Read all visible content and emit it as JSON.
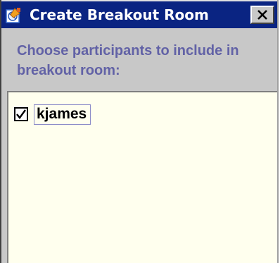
{
  "window": {
    "title": "Create Breakout Room",
    "title_icon": "app-icon",
    "close_icon": "close-icon"
  },
  "colors": {
    "titlebar": "#0a2482",
    "window_bg": "#c8c8c8",
    "instruction_text": "#6262a6",
    "list_bg": "#ffffee"
  },
  "instruction": "Choose participants to include in breakout room:",
  "participants": [
    {
      "name": "kjames",
      "checked": true
    }
  ]
}
